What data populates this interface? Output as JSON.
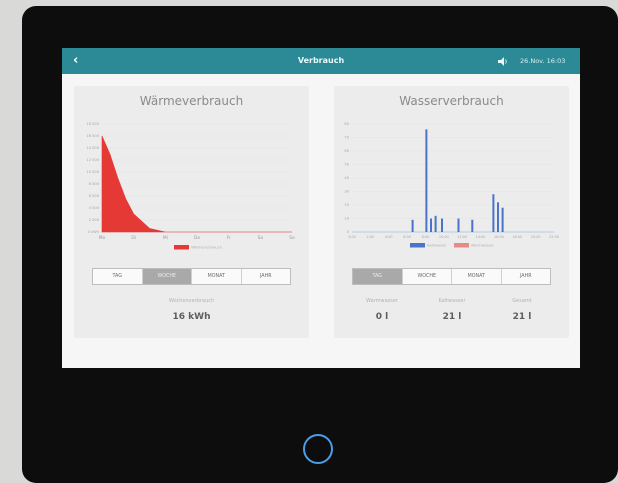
{
  "header": {
    "title": "Verbrauch",
    "datetime": "26.Nov. 16:03"
  },
  "heat": {
    "title": "Wärmeverbrauch",
    "chart_data": {
      "type": "area",
      "title": "Wärmeverbrauch",
      "categories": [
        "Mo",
        "Di",
        "Mi",
        "Do",
        "Fr",
        "Sa",
        "So"
      ],
      "x": [
        0,
        0.25,
        0.5,
        0.75,
        1,
        1.5,
        2,
        3,
        4,
        5,
        6
      ],
      "values": [
        16000,
        13000,
        9000,
        5500,
        3000,
        600,
        0,
        0,
        0,
        0,
        0
      ],
      "yticks": [
        "18 000",
        "16 000",
        "14 000",
        "12 000",
        "10 000",
        "8 000",
        "6 000",
        "4 000",
        "2 000",
        "0 kWh"
      ],
      "ylim": [
        0,
        18000
      ],
      "color": "#e53935",
      "legend": [
        "Wärmeverbrauch"
      ]
    },
    "tabs": [
      "TAG",
      "WOCHE",
      "MONAT",
      "JAHR"
    ],
    "active_tab": "WOCHE",
    "stat_label": "Wochenverbrauch",
    "stat_value": "16 kWh"
  },
  "water": {
    "title": "Wasserverbrauch",
    "chart_data": {
      "type": "bar",
      "title": "Wasserverbrauch",
      "xticks": [
        "0:00",
        "2:00",
        "4:00",
        "6:00",
        "8:00",
        "10:00",
        "12:00",
        "14:00",
        "16:00",
        "18:00",
        "20:00",
        "22:00"
      ],
      "yticks": [
        "80",
        "70",
        "60",
        "50",
        "40",
        "30",
        "20",
        "10",
        "0"
      ],
      "ylim": [
        0,
        80
      ],
      "series": [
        {
          "name": "Kaltwasser",
          "color": "#4a73c9",
          "x": [
            6.6,
            8.1,
            8.6,
            9.1,
            9.8,
            11.6,
            13.1,
            15.4,
            15.9,
            16.4
          ],
          "values": [
            9,
            76,
            10,
            12,
            10,
            10,
            9,
            28,
            22,
            18
          ]
        },
        {
          "name": "Warmwasser",
          "color": "#e88a8a",
          "x": [],
          "values": []
        }
      ],
      "legend": [
        "Kaltwasser",
        "Warmwasser"
      ]
    },
    "tabs": [
      "TAG",
      "WOCHE",
      "MONAT",
      "JAHR"
    ],
    "active_tab": "TAG",
    "stats": [
      {
        "label": "Warmwasser",
        "value": "0 l"
      },
      {
        "label": "Kaltwasser",
        "value": "21 l"
      },
      {
        "label": "Gesamt",
        "value": "21 l"
      }
    ]
  },
  "colors": {
    "topbar": "#2b8a96",
    "home_ring": "#4a9ee8"
  },
  "icons": [
    "back-arrow-icon",
    "speaker-icon",
    "home-ring-icon"
  ]
}
